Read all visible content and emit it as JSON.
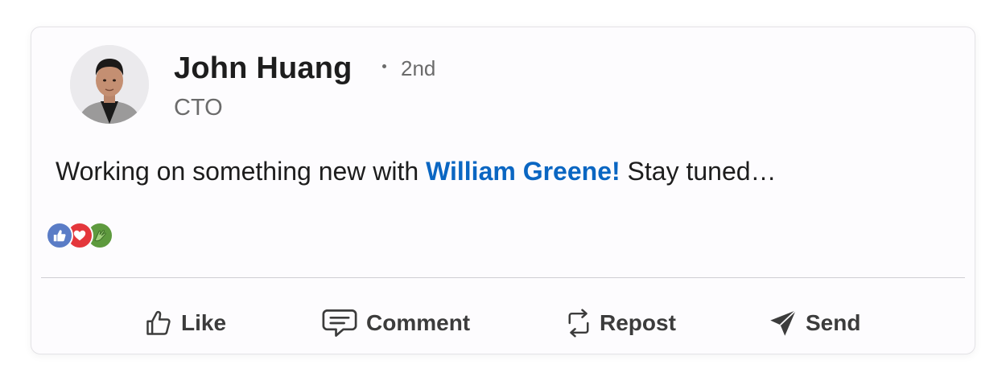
{
  "post": {
    "author": {
      "name": "John Huang",
      "degree": "2nd",
      "title": "CTO"
    },
    "text_before": "Working on something new with ",
    "mention": "William Greene!",
    "text_after": " Stay tuned…",
    "reactions": [
      "like-icon",
      "love-icon",
      "celebrate-icon"
    ],
    "actions": {
      "like": "Like",
      "comment": "Comment",
      "repost": "Repost",
      "send": "Send"
    }
  },
  "colors": {
    "mention": "#0a66c2",
    "like": "#5a7cc6",
    "love": "#e4373c",
    "celebrate": "#5e9a3e"
  }
}
